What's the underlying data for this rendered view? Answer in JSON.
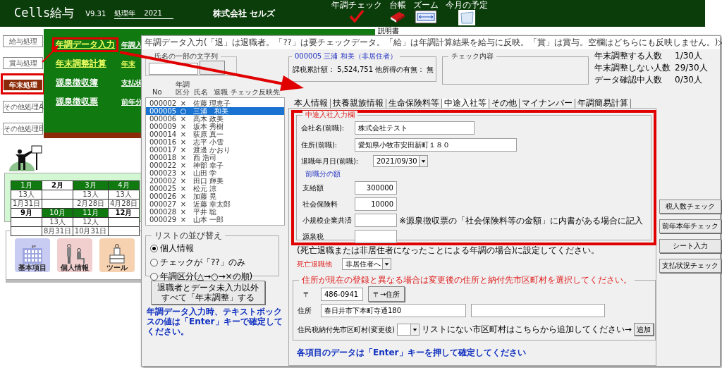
{
  "header": {
    "app_name": "Cells給与",
    "version": "V9.31",
    "year_label": "処理年",
    "year": "2021",
    "company": "株式会社 セルズ",
    "tools": [
      {
        "label": "年調チェック",
        "kind": "check"
      },
      {
        "label": "台帳",
        "kind": "book"
      },
      {
        "label": "ズーム",
        "kind": "zoom"
      },
      {
        "label": "今月の予定",
        "kind": "calendar"
      }
    ]
  },
  "menu": [
    {
      "label": "給与処理",
      "selected": false,
      "callout": false
    },
    {
      "label": "賞与処理",
      "selected": false,
      "callout": false
    },
    {
      "label": "年末処理",
      "selected": true,
      "callout": true
    },
    {
      "label": "その他処理A",
      "selected": false,
      "callout": false
    },
    {
      "label": "その他処理B",
      "selected": false,
      "callout": false
    }
  ],
  "board": {
    "columns": [
      [
        {
          "label": "年調データ入力",
          "highlighted": true,
          "callout": true
        },
        {
          "label": "年末調整計算",
          "highlighted": true,
          "callout": false
        },
        {
          "label": "源泉徴収簿",
          "highlighted": false,
          "callout": false
        },
        {
          "label": "源泉徴収票",
          "highlighted": false,
          "callout": false
        }
      ],
      [
        {
          "label": "年調入",
          "highlighted": false,
          "callout": false
        },
        {
          "label": "年末",
          "highlighted": true,
          "callout": false
        },
        {
          "label": "支払状",
          "highlighted": false,
          "callout": false
        },
        {
          "label": "前年分",
          "highlighted": false,
          "callout": false
        }
      ]
    ]
  },
  "manual_label": "説明書",
  "calendar": {
    "rows": [
      [
        {
          "month": "1月",
          "active": true,
          "count": "13人",
          "date": "1月31日"
        },
        {
          "month": "2月",
          "active": false
        },
        {
          "month": "3月",
          "active": true,
          "count": "13人",
          "date": "2月28日"
        },
        {
          "month": "4月",
          "active": true,
          "count": "13人",
          "date": "4月28日"
        }
      ],
      [
        {
          "month": "9月",
          "active": false
        },
        {
          "month": "10月",
          "active": true,
          "count": "13人",
          "date": "8月31日"
        },
        {
          "month": "11月",
          "active": true,
          "count": "12人",
          "date": "10月31日"
        },
        {
          "month": "12月",
          "active": false
        }
      ]
    ]
  },
  "shortcuts": [
    {
      "label": "基本項目",
      "kind": "building"
    },
    {
      "label": "個人情報",
      "kind": "people"
    },
    {
      "label": "ツール",
      "kind": "tools"
    }
  ],
  "dialog": {
    "title": "年調データ入力(「退」は退職者。「??」は要チェックデータ。「給」は年調計算結果を給与に反映。「賞」は賞与。空欄はどちらにも反映しません。)",
    "search_legend": "氏名の一部の文字列",
    "columns": [
      "No",
      "年調区分",
      "氏名",
      "退職",
      "チェック",
      "反映先"
    ],
    "employees": [
      {
        "no": "000002",
        "kubun": "×",
        "name": "佐藤 理恵子",
        "selected": false
      },
      {
        "no": "000005",
        "kubun": "○",
        "name": "三浦　和美",
        "selected": true
      },
      {
        "no": "000006",
        "kubun": "×",
        "name": "髙木 政美",
        "selected": false
      },
      {
        "no": "000009",
        "kubun": "×",
        "name": "坂本 秀樹",
        "selected": false
      },
      {
        "no": "000014",
        "kubun": "×",
        "name": "荻原 真一",
        "selected": false
      },
      {
        "no": "000016",
        "kubun": "×",
        "name": "志平 小雪",
        "selected": false
      },
      {
        "no": "000017",
        "kubun": "×",
        "name": "渡邊 かおり",
        "selected": false
      },
      {
        "no": "000018",
        "kubun": "×",
        "name": "西 浩司",
        "selected": false
      },
      {
        "no": "000022",
        "kubun": "×",
        "name": "神部 幸子",
        "selected": false
      },
      {
        "no": "000023",
        "kubun": "×",
        "name": "山田 学",
        "selected": false
      },
      {
        "no": "200002",
        "kubun": "×",
        "name": "田口 輝美",
        "selected": false
      },
      {
        "no": "000025",
        "kubun": "×",
        "name": "松元 涼",
        "selected": false
      },
      {
        "no": "000026",
        "kubun": "×",
        "name": "加藤 晃",
        "selected": false
      },
      {
        "no": "000027",
        "kubun": "×",
        "name": "近藤 幸太郎",
        "selected": false
      },
      {
        "no": "000028",
        "kubun": "×",
        "name": "平井 聡",
        "selected": false
      },
      {
        "no": "000029",
        "kubun": "×",
        "name": "山本 一郎",
        "selected": false
      }
    ],
    "sort": {
      "legend": "リストの並び替え",
      "options": [
        {
          "label": "個人情報",
          "selected": true
        },
        {
          "label": "チェックが「??」のみ",
          "selected": false
        },
        {
          "label": "年調区分(△→○→×の順)",
          "selected": false
        }
      ]
    },
    "bulk_button": "退職者とデータ未入力以外すべて「年末調整」する",
    "left_note": "年調データ入力時、テキストボックスの値は「Enter」キーで確定してください。",
    "employee_header": "000005 三浦 和美（非居住者）",
    "employee_info": "課税累計額： 5,524,751 他所得の有無： 無",
    "check_legend": "チェック内容",
    "counts": [
      {
        "label": "年末調整する人数",
        "value": "1/30人"
      },
      {
        "label": "年末調整しない人数",
        "value": "29/30人"
      },
      {
        "label": "データ確認中人数",
        "value": "0/30人"
      }
    ],
    "tabs": [
      {
        "label": "本人情報",
        "selected": false
      },
      {
        "label": "扶養親族情報",
        "selected": false
      },
      {
        "label": "生命保険料等",
        "selected": false
      },
      {
        "label": "中途入社等",
        "selected": true
      },
      {
        "label": "その他",
        "selected": false
      },
      {
        "label": "マイナンバー",
        "selected": false
      },
      {
        "label": "年調簡易計算",
        "selected": false
      }
    ],
    "form": {
      "legend": "中途入社入力欄",
      "callout": true,
      "company_label": "会社名(前職):",
      "company": "株式会社テスト",
      "address_label": "住所(前職):",
      "address": "愛知県小牧市安田新町１８０",
      "retire_label": "退職年月日(前職):",
      "retire_date": "2021/09/30",
      "amounts_heading": "前職分の額",
      "amounts": [
        {
          "label": "支給額",
          "value": "300000"
        },
        {
          "label": "社会保険料",
          "value": "10000"
        },
        {
          "label": "小規模企業共済",
          "note": "※源泉徴収票の「社会保険料等の金額」に内書がある場合に記入"
        },
        {
          "label": "源泉税"
        }
      ]
    },
    "death_note": "(死亡退職または非居住者になったことによる年調の場合)に設定してください。",
    "death_label": "死亡退職他",
    "death_value": "非居住者へ",
    "address_group": {
      "legend": "住所が現在の登録と異なる場合は変更後の住所と納付先市区町村を選択してください。",
      "zip_label": "〒",
      "zip": "486-0941",
      "zip_button": "〒→住所",
      "address_label": "住所",
      "address": "春日井市下本町寺通180",
      "city_label": "住民税納付先市区町村(変更後)",
      "city_hint": "リストにない市区町村はこちらから追加してください→",
      "add_button": "追加"
    },
    "bottom_note": "各項目のデータは「Enter」キーを押して確定してください",
    "side_buttons": [
      "税人数チェック",
      "前年本年チェック",
      "シート入力",
      "支払状況チェック"
    ]
  }
}
